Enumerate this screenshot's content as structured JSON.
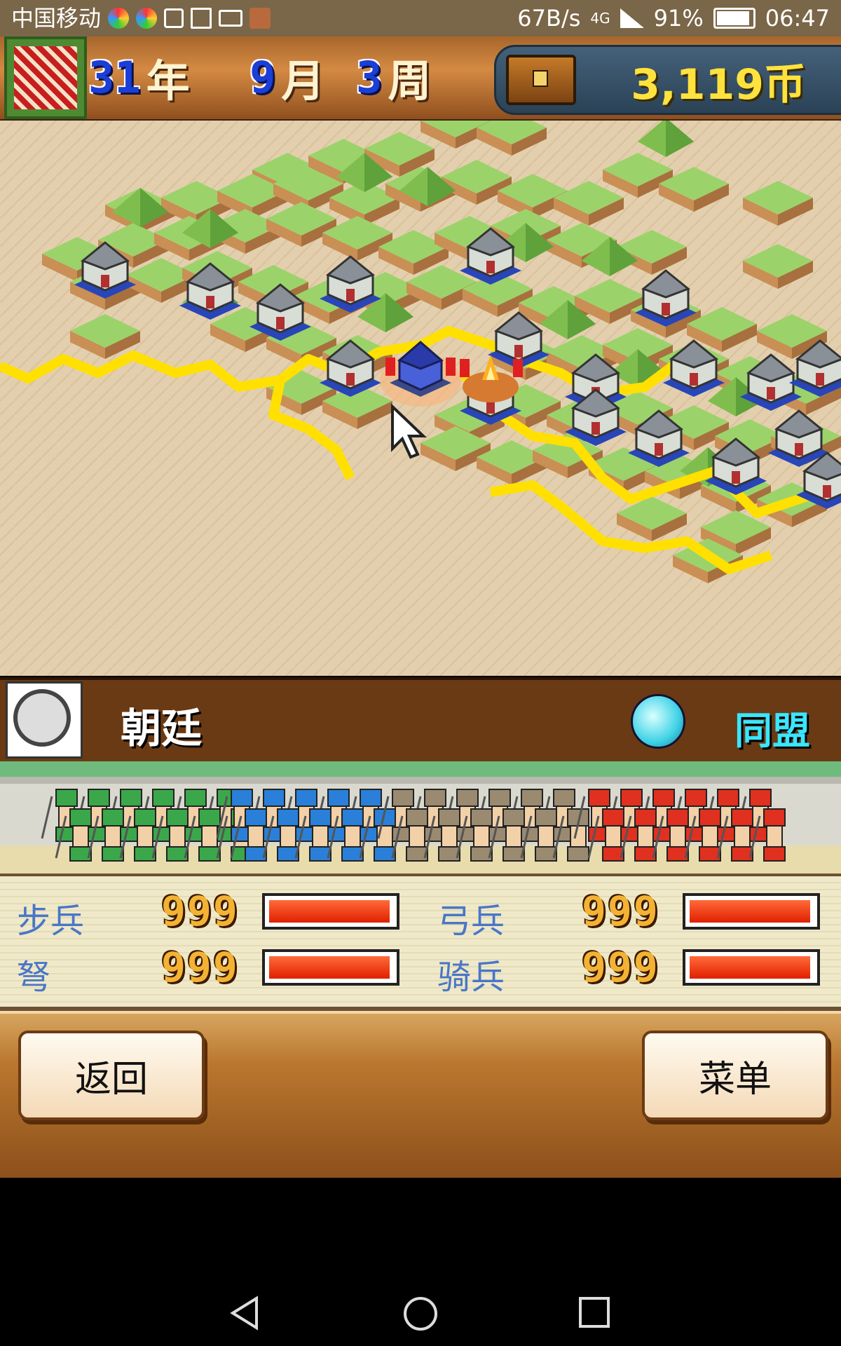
{
  "status_bar": {
    "carrier": "中国移动",
    "net_speed": "67B/s",
    "network": "4G",
    "battery": "91%",
    "time": "06:47"
  },
  "header": {
    "year_num": "31",
    "year_unit": "年",
    "month_num": "9",
    "month_unit": "月",
    "week_num": "3",
    "week_unit": "周",
    "money": "3,119币"
  },
  "faction": {
    "name": "朝廷",
    "relation": "同盟",
    "relation_color": "#39e6ff"
  },
  "stats": [
    {
      "label": "步兵",
      "value": "999",
      "fill": 1.0
    },
    {
      "label": "弓兵",
      "value": "999",
      "fill": 1.0
    },
    {
      "label": "弩",
      "value": "999",
      "fill": 1.0
    },
    {
      "label": "骑兵",
      "value": "999",
      "fill": 1.0
    }
  ],
  "buttons": {
    "back": "返回",
    "menu": "菜单"
  },
  "nav": {
    "back_icon": "triangle-back-icon",
    "home_icon": "circle-home-icon",
    "recent_icon": "square-recent-icon"
  }
}
